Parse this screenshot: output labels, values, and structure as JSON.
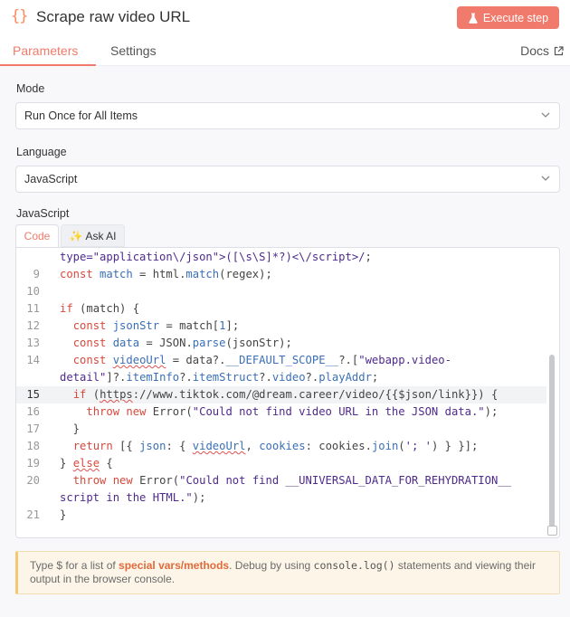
{
  "header": {
    "icon_glyph": "{}",
    "title": "Scrape raw video URL",
    "execute_label": "Execute step",
    "execute_color": "#f07a6b"
  },
  "tabs": {
    "parameters": "Parameters",
    "settings": "Settings",
    "docs": "Docs"
  },
  "mode": {
    "label": "Mode",
    "value": "Run Once for All Items"
  },
  "language": {
    "label": "Language",
    "value": "JavaScript"
  },
  "editor": {
    "label": "JavaScript",
    "tab_code": "Code",
    "tab_ai": "Ask AI",
    "ai_glyph": "✨"
  },
  "hint": {
    "p1": "Type $ for a list of ",
    "link": "special vars/methods",
    "p2": ". Debug by using ",
    "code": "console.log()",
    "p3": " statements and viewing their output in the browser console."
  }
}
